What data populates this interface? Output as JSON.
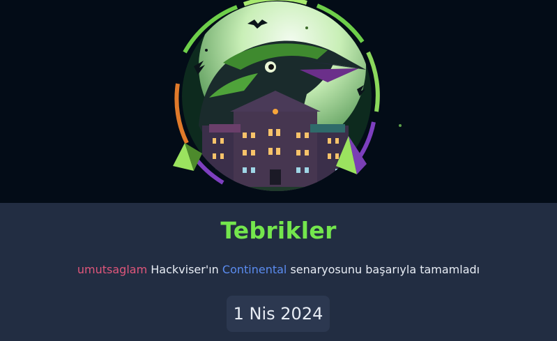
{
  "title": "Tebrikler",
  "message": {
    "username": "umutsaglam",
    "platform_text": "Hackviser'ın",
    "scenario": "Continental",
    "suffix": "senaryosunu başarıyla tamamladı"
  },
  "date": "1 Nis 2024",
  "colors": {
    "title": "#74e64d",
    "username": "#e0567b",
    "scenario": "#5b8cf0",
    "panel_bg": "#222d42",
    "banner_bg": "#030c17",
    "date_badge_bg": "#2c3850"
  },
  "banner": {
    "illustration": "raven-over-mansion-badge-icon"
  }
}
